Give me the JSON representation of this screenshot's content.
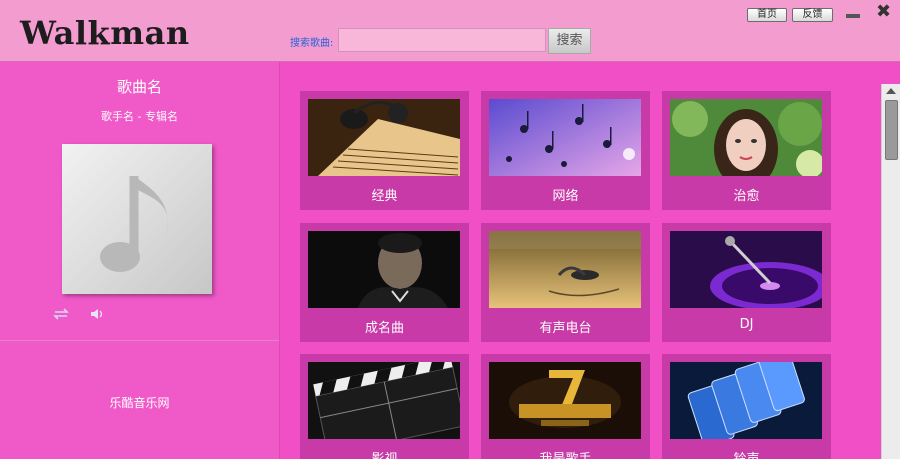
{
  "app": {
    "logo": "Walkman"
  },
  "header": {
    "search_label": "搜索歌曲:",
    "search_value": "",
    "search_button": "搜索",
    "home_button": "首页",
    "feedback_button": "反馈"
  },
  "player": {
    "song_title": "歌曲名",
    "song_meta": "歌手名 - 专辑名",
    "site_name": "乐酷音乐网"
  },
  "categories": [
    {
      "label": "经典",
      "image": "sheet-music-headphones"
    },
    {
      "label": "网络",
      "image": "floating-music-notes"
    },
    {
      "label": "治愈",
      "image": "girl-portrait"
    },
    {
      "label": "成名曲",
      "image": "singer-portrait"
    },
    {
      "label": "有声电台",
      "image": "headphones-on-table"
    },
    {
      "label": "DJ",
      "image": "turntable-purple"
    },
    {
      "label": "影视",
      "image": "film-clapperboard"
    },
    {
      "label": "我是歌手",
      "image": "singer-show-logo"
    },
    {
      "label": "铃声",
      "image": "smartphones"
    }
  ],
  "colors": {
    "accent": "#f04fc6",
    "tile": "#c83aa7",
    "header": "#f29ccf"
  }
}
